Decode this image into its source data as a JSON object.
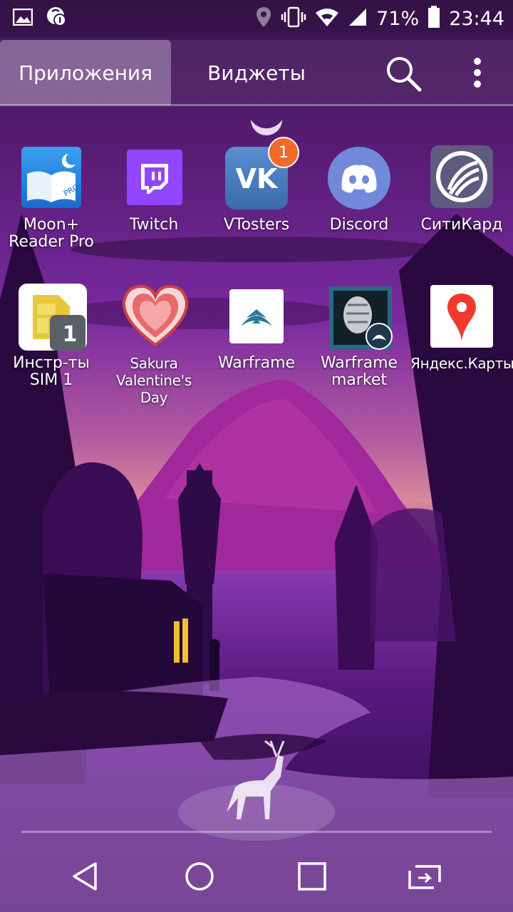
{
  "status_bar": {
    "icons_left": [
      "gallery-icon",
      "sync-notification-icon"
    ],
    "icons_right": [
      "location-icon",
      "vibrate-icon",
      "wifi-icon",
      "signal-icon",
      "battery-icon"
    ],
    "battery": "71%",
    "time": "23:44"
  },
  "tabs": {
    "apps_label": "Приложения",
    "widgets_label": "Виджеты",
    "selected": "Приложения"
  },
  "apps": [
    {
      "label": "Moon+\nReader Pro",
      "icon": "moon-reader-icon"
    },
    {
      "label": "Twitch",
      "icon": "twitch-icon"
    },
    {
      "label": "VTosters",
      "icon": "vk-icon",
      "badge": "1"
    },
    {
      "label": "Discord",
      "icon": "discord-icon"
    },
    {
      "label": "СитиКард",
      "icon": "citycard-icon"
    },
    {
      "label": "Инстр-ты\nSIM 1",
      "icon": "sim-tools-icon",
      "sim_number": "1"
    },
    {
      "label": "Sakura\nValentine's Day",
      "icon": "heart-icon"
    },
    {
      "label": "Warframe",
      "icon": "warframe-icon"
    },
    {
      "label": "Warframe\nmarket",
      "icon": "warframe-market-icon"
    },
    {
      "label": "Яндекс.Карты",
      "icon": "yandex-maps-icon"
    }
  ],
  "navigation": [
    "back-icon",
    "home-icon",
    "recents-icon",
    "switch-icon"
  ],
  "colors": {
    "twitch": "#9146ff",
    "vk": "#4a76a8",
    "discord": "#7289da",
    "badge": "#f06a2a",
    "yandex_pin": "#f03a2e"
  }
}
